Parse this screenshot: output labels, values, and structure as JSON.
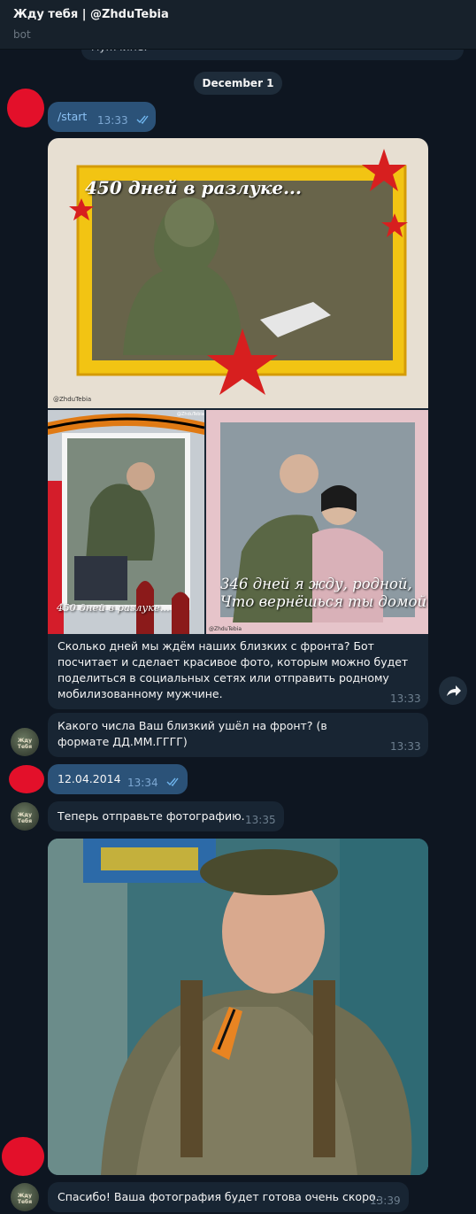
{
  "header": {
    "title": "Жду тебя | @ZhduTebia",
    "subtitle": "bot"
  },
  "prev_tail": "мужчине.",
  "date_divider": "December 1",
  "messages": {
    "m1": {
      "text": "/start",
      "time": "13:33"
    },
    "album": {
      "img1_caption": "450 дней в разлуке...",
      "img1_watermark": "@ZhduTebia",
      "img2_caption": "450 дней в разлуке...",
      "img2_watermark": "@ZhduTebia",
      "img3_caption_line1": "346 дней я жду, родной,",
      "img3_caption_line2": "Что вернёшься ты домой",
      "img3_watermark": "@ZhduTebia",
      "text": "Сколько дней мы ждём наших близких с фронта? Бот посчитает и сделает красивое фото, которым можно будет поделиться в социальных сетях или отправить родному мобилизованному мужчине.",
      "time": "13:33"
    },
    "m3": {
      "text": "Какого числа Ваш близкий ушёл на фронт? (в формате ДД.ММ.ГГГГ)",
      "time": "13:33"
    },
    "m4": {
      "text": "12.04.2014",
      "time": "13:34"
    },
    "m5": {
      "text": "Теперь отправьте фотографию.",
      "time": "13:35"
    },
    "m7": {
      "text": "Спасибо! Ваша фотография будет готова очень скоро.",
      "time": "13:39"
    }
  },
  "bot_avatar_label": "Жду Тебя",
  "colors": {
    "bg": "#0e1621",
    "incoming": "#182533",
    "outgoing": "#2b5278",
    "avatar_redaction": "#e3102a"
  }
}
